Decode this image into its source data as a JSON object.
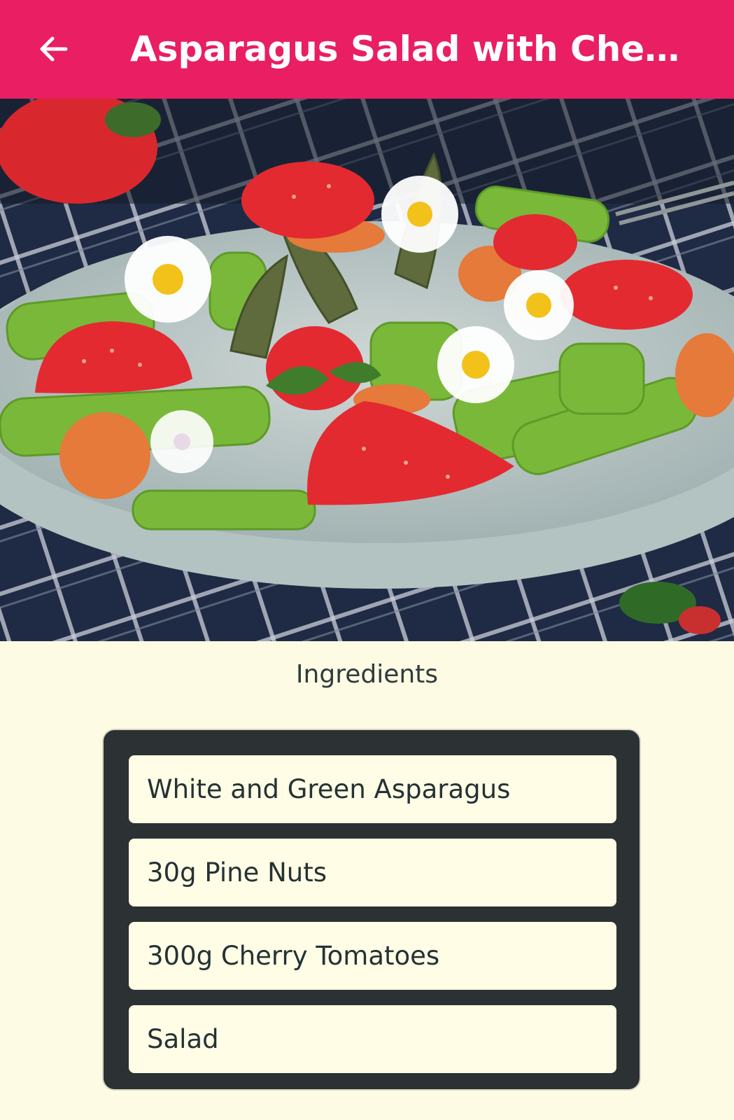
{
  "app_bar": {
    "title": "Asparagus Salad with Cherry ...",
    "background_color": "#e91e63",
    "back_icon": "arrow-back-icon"
  },
  "hero_image": {
    "subject": "asparagus-strawberry-salad-photo"
  },
  "ingredients": {
    "title": "Ingredients",
    "items": [
      "White and Green Asparagus",
      "30g Pine Nuts",
      "300g Cherry Tomatoes",
      "Salad"
    ]
  },
  "colors": {
    "page_background": "#fdfbe3",
    "card_background": "#2c3133",
    "item_background": "#fffde6",
    "text": "#253234"
  }
}
